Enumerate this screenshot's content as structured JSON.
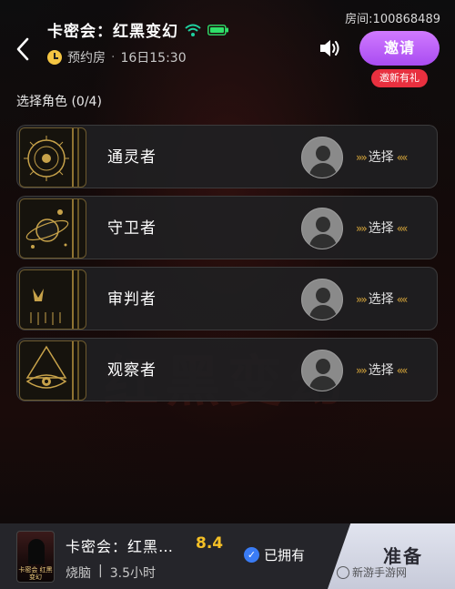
{
  "header": {
    "room_title": "卡密会：红黑变幻",
    "schedule_prefix": "预约房",
    "schedule_time": "16日15:30",
    "room_id": "房间:100868489",
    "invite_label": "邀请",
    "invite_badge": "邀新有礼"
  },
  "role_section": {
    "label": "选择角色 (0/4)"
  },
  "roles": [
    {
      "name": "通灵者",
      "select_label": "选择"
    },
    {
      "name": "守卫者",
      "select_label": "选择"
    },
    {
      "name": "审判者",
      "select_label": "选择"
    },
    {
      "name": "观察者",
      "select_label": "选择"
    }
  ],
  "background_title": "红黑变幻",
  "bottom_bar": {
    "game_name": "卡密会：红黑…",
    "rating": "8.4",
    "genre": "烧脑",
    "divider": "|",
    "duration": "3.5小时",
    "owned_label": "已拥有",
    "ready_label": "准备",
    "cover_title": "卡密会 红黑变幻"
  },
  "watermark": "新游手游网",
  "colors": {
    "invite_gradient_top": "#d07aff",
    "invite_gradient_bottom": "#a94cf1",
    "badge_red": "#e8303f",
    "rating_yellow": "#f5c026",
    "owned_blue": "#3a7cf5",
    "wifi_green": "#1fd1a0",
    "battery_green": "#2fe06a"
  },
  "icons": [
    "back-arrow-icon",
    "wifi-icon",
    "battery-icon",
    "clock-icon",
    "speaker-icon",
    "avatar-placeholder-icon",
    "chevron-double-right-icon",
    "chevron-double-left-icon",
    "check-icon"
  ]
}
